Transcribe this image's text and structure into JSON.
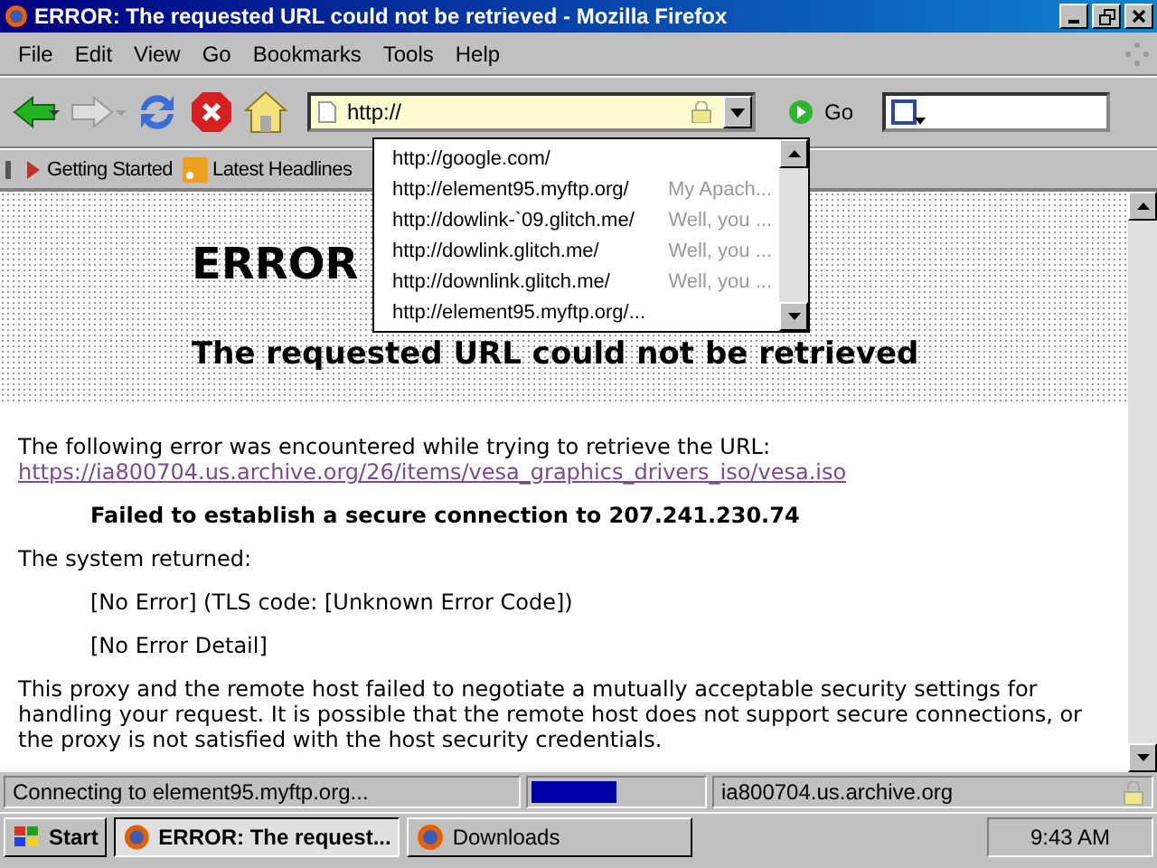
{
  "window": {
    "title": "ERROR: The requested URL could not be retrieved - Mozilla Firefox"
  },
  "menu": [
    {
      "label": "File"
    },
    {
      "label": "Edit"
    },
    {
      "label": "View"
    },
    {
      "label": "Go"
    },
    {
      "label": "Bookmarks"
    },
    {
      "label": "Tools"
    },
    {
      "label": "Help"
    }
  ],
  "toolbar": {
    "address": "http://",
    "go": "Go"
  },
  "autocomplete": [
    {
      "url": "http://google.com/"
    },
    {
      "url": "http://element95.myftp.org/",
      "title": "My Apach..."
    },
    {
      "url": "http://dowlink-`09.glitch.me/",
      "title": "Well, you ..."
    },
    {
      "url": "http://dowlink.glitch.me/",
      "title": "Well, you ..."
    },
    {
      "url": "http://downlink.glitch.me/",
      "title": "Well, you ..."
    },
    {
      "url": "http://element95.myftp.org/..."
    }
  ],
  "bookmarks": [
    {
      "label": "Getting Started",
      "kind": "page"
    },
    {
      "label": "Latest Headlines",
      "kind": "feed"
    }
  ],
  "page": {
    "heading": "ERROR",
    "subheading": "The requested URL could not be retrieved",
    "intro": "The following error was encountered while trying to retrieve the URL:",
    "link": "https://ia800704.us.archive.org/26/items/vesa_graphics_drivers_iso/vesa.iso",
    "failure": "Failed to establish a secure connection to 207.241.230.74",
    "returned": "The system returned:",
    "codes": [
      "[No Error] (TLS code: [Unknown Error Code])",
      "[No Error Detail]"
    ],
    "explanation": "This proxy and the remote host failed to negotiate a mutually acceptable security settings for handling your request. It is possible that the remote host does not support secure connections, or the proxy is not satisfied with the host security credentials."
  },
  "status_bar": {
    "text": "Connecting to element95.myftp.org...",
    "level": 0.5,
    "host": "ia800704.us.archive.org"
  },
  "taskbar": {
    "start": "Start",
    "tasks": [
      {
        "label": "ERROR: The request...",
        "selected": true
      },
      {
        "label": "Downloads",
        "selected": false
      }
    ],
    "clock": "9:43 AM"
  }
}
